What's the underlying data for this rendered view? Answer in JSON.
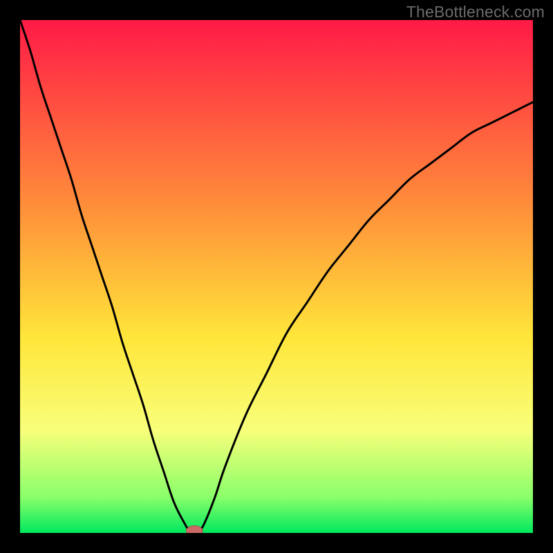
{
  "watermark": "TheBottleneck.com",
  "colors": {
    "gradient_top": "#ff1a47",
    "gradient_mid_upper": "#ff8a3a",
    "gradient_mid": "#ffe63a",
    "gradient_lower": "#f8ff7a",
    "gradient_green_top": "#8aff6a",
    "gradient_green_bottom": "#00e85e",
    "curve": "#000000",
    "marker_fill": "#cc6a66",
    "marker_stroke": "#a84f4b",
    "frame": "#000000"
  },
  "chart_data": {
    "type": "line",
    "title": "",
    "xlabel": "",
    "ylabel": "",
    "xlim": [
      0,
      100
    ],
    "ylim": [
      0,
      100
    ],
    "series": [
      {
        "name": "bottleneck-curve",
        "x": [
          0,
          2,
          4,
          6,
          8,
          10,
          12,
          14,
          16,
          18,
          20,
          22,
          24,
          26,
          28,
          30,
          32,
          33,
          34,
          35,
          36,
          38,
          40,
          44,
          48,
          52,
          56,
          60,
          64,
          68,
          72,
          76,
          80,
          84,
          88,
          92,
          96,
          100
        ],
        "y": [
          100,
          94,
          87,
          81,
          75,
          69,
          62,
          56,
          50,
          44,
          37,
          31,
          25,
          18,
          12,
          6,
          2,
          0.5,
          0,
          0.5,
          2,
          7,
          13,
          23,
          31,
          39,
          45,
          51,
          56,
          61,
          65,
          69,
          72,
          75,
          78,
          80,
          82,
          84
        ]
      }
    ],
    "marker": {
      "x": 34,
      "y": 0,
      "rx": 1.6,
      "ry": 1.0
    },
    "gradient_stops": [
      {
        "pos": 0.0,
        "hint": "red"
      },
      {
        "pos": 0.35,
        "hint": "orange"
      },
      {
        "pos": 0.62,
        "hint": "yellow"
      },
      {
        "pos": 0.8,
        "hint": "pale-yellow"
      },
      {
        "pos": 0.93,
        "hint": "light-green"
      },
      {
        "pos": 1.0,
        "hint": "green"
      }
    ]
  }
}
